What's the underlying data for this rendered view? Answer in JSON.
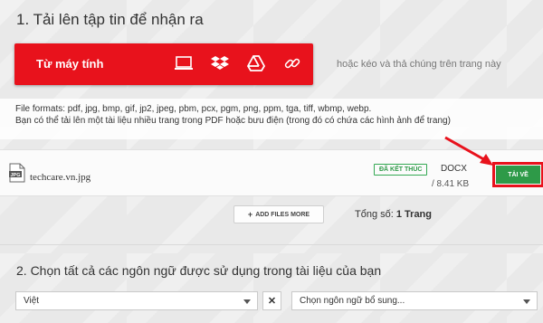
{
  "section1": {
    "title": "1. Tải lên tập tin để nhận ra",
    "upload_button_label": "Từ máy tính",
    "sources": [
      "computer-icon",
      "dropbox-icon",
      "google-drive-icon",
      "link-icon"
    ],
    "upload_hint": "hoặc kéo và thả chúng trên trang này",
    "formats_line": "File formats: pdf, jpg, bmp, gif, jp2, jpeg, pbm, pcx, pgm, png, ppm, tga, tiff, wbmp, webp.",
    "multipage_line": "Bạn có thể tải lên một tài liệu nhiều trang trong PDF hoặc bưu điện (trong đó có chứa các hình ảnh để trang)"
  },
  "file": {
    "icon_text": "JPG",
    "name": "techcare.vn.jpg",
    "status": "ĐÃ KẾT THÚC",
    "output_format": "DOCX",
    "output_size": "/ 8.41 KB",
    "download_label": "TẢI VỀ"
  },
  "actions": {
    "add_files_label": "ADD FILES MORE",
    "page_total_label": "Tổng số:",
    "page_total_value": "1 Trang"
  },
  "section2": {
    "title": "2. Chọn tất cả các ngôn ngữ được sử dụng trong tài liệu của bạn",
    "language_selected": "Việt",
    "clear_label": "✕",
    "add_language_placeholder": "Chọn ngôn ngữ bổ sung..."
  },
  "colors": {
    "brand_red": "#e8121c",
    "success_green": "#2e9a48"
  }
}
